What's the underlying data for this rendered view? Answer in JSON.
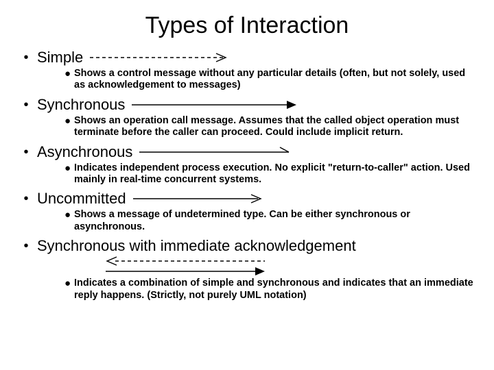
{
  "title": "Types of Interaction",
  "items": [
    {
      "label": "Simple",
      "desc": "Shows a control message without any particular details (often, but not solely, used as acknowledgement to messages)"
    },
    {
      "label": "Synchronous",
      "desc": "Shows an operation call message. Assumes that the called object operation must terminate before the caller can proceed. Could include implicit return."
    },
    {
      "label": "Asynchronous",
      "desc": "Indicates independent process execution. No explicit \"return-to-caller\" action. Used mainly in real-time concurrent systems."
    },
    {
      "label": "Uncommitted",
      "desc": "Shows a message of undetermined type. Can be either synchronous or asynchronous."
    },
    {
      "label": "Synchronous with immediate acknowledgement",
      "desc": "Indicates a combination of simple and synchronous and indicates that an immediate reply happens. (Strictly, not purely UML notation)"
    }
  ]
}
